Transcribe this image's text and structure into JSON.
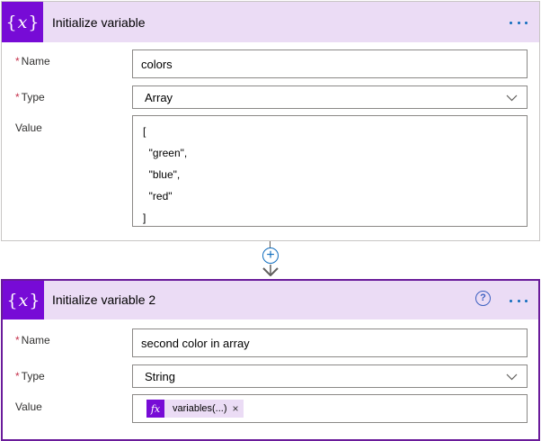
{
  "cards": [
    {
      "title": "Initialize variable",
      "icon": "variable-icon",
      "name_label": "Name",
      "name_value": "colors",
      "type_label": "Type",
      "type_value": "Array",
      "value_label": "Value",
      "value_text": "[\n  \"green\",\n  \"blue\",\n  \"red\"\n]"
    },
    {
      "title": "Initialize variable 2",
      "icon": "variable-icon",
      "name_label": "Name",
      "name_value": "second color in array",
      "type_label": "Type",
      "type_value": "String",
      "value_label": "Value",
      "token_icon": "fx",
      "token_label": "variables(...)",
      "token_remove": "×"
    }
  ],
  "required_marker": "*",
  "icon_glyph_left": "{",
  "icon_glyph_mid": "x",
  "icon_glyph_right": "}",
  "help_glyph": "?",
  "add_glyph": "+",
  "colors": {
    "header_bg": "#ebdcf5",
    "icon_bg": "#770bd6",
    "accent_blue": "#0f6cbd",
    "required_red": "#c4314b",
    "selected_border": "#6a1b9a"
  }
}
